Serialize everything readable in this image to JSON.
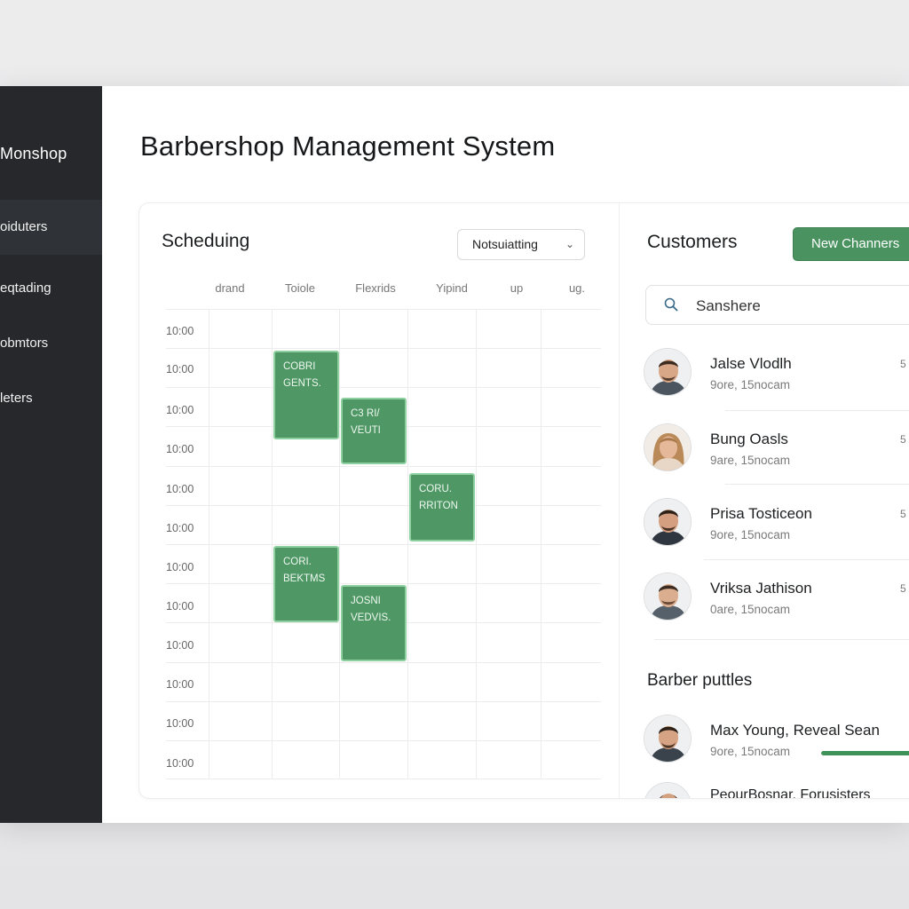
{
  "sidebar": {
    "brand": "Monshop",
    "items": [
      {
        "label": "oiduters",
        "active": true
      },
      {
        "label": "eqtading",
        "active": false
      },
      {
        "label": "obmtors",
        "active": false
      },
      {
        "label": "leters",
        "active": false
      }
    ]
  },
  "page_title": "Barbershop Management System",
  "schedule": {
    "title": "Scheduing",
    "select_value": "Notsuiatting",
    "columns": [
      "drand",
      "Toiole",
      "Flexrids",
      "Yipind",
      "up",
      "ug."
    ],
    "times": [
      "10:00",
      "10:00",
      "10:00",
      "10:00",
      "10:00",
      "10:00",
      "10:00",
      "10:00",
      "10:00",
      "10:00",
      "10:00",
      "10:00"
    ],
    "appointments": [
      {
        "line1": "COBRI",
        "line2": "GENTS."
      },
      {
        "line1": "C3 RI/",
        "line2": "VEUTI"
      },
      {
        "line1": "CORU.",
        "line2": "RRITON"
      },
      {
        "line1": "CORI.",
        "line2": "BEKTMS"
      },
      {
        "line1": "JOSNI",
        "line2": "VEDVIS."
      }
    ],
    "accent_color": "#4f9765"
  },
  "customers": {
    "title": "Customers",
    "new_button": "New Channers",
    "search_value": "Sanshere",
    "list": [
      {
        "name": "Jalse Vlodlh",
        "sub": "9ore, 15nocam",
        "meta": "5"
      },
      {
        "name": "Bung Oasls",
        "sub": "9are, 15nocam",
        "meta": "5"
      },
      {
        "name": "Prisa Tosticeon",
        "sub": "9ore, 15nocam",
        "meta": "5"
      },
      {
        "name": "Vriksa Jathison",
        "sub": "0are, 15nocam",
        "meta": "5"
      }
    ]
  },
  "barber_profiles": {
    "title": "Barber puttles",
    "list": [
      {
        "name": "Max Young, Reveal Sean",
        "sub": "9ore, 15nocam",
        "progress": 0.65
      },
      {
        "name": "PeourBosnar, Forusisters",
        "sub": ""
      }
    ]
  }
}
